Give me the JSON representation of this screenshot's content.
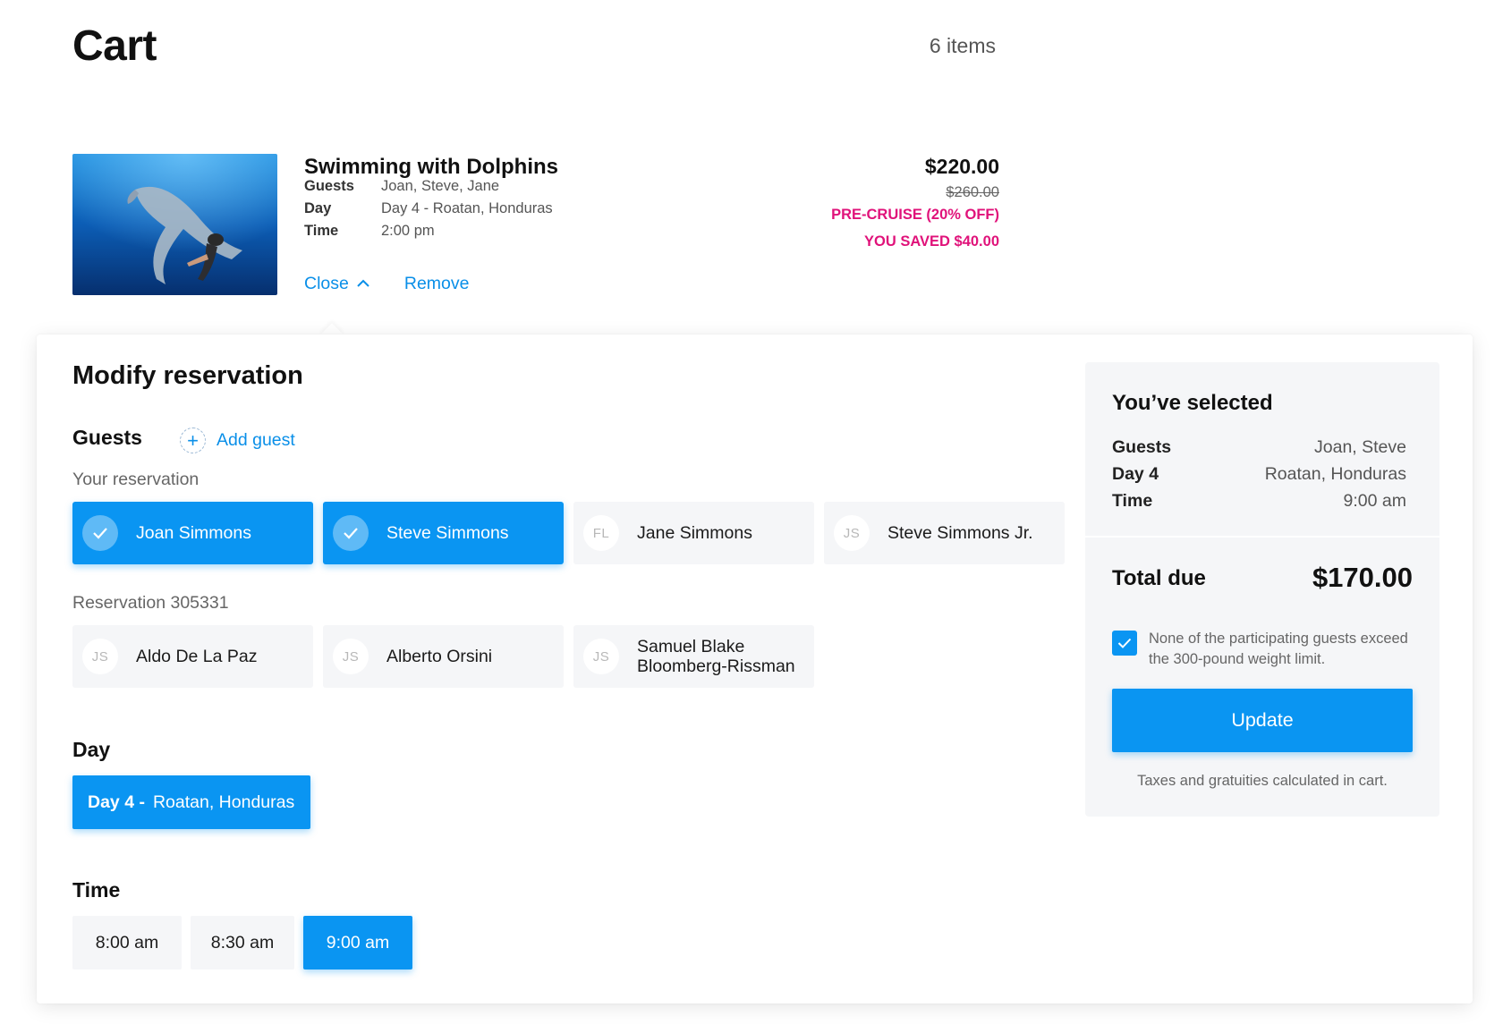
{
  "page": {
    "title": "Cart",
    "items_count": "6 items"
  },
  "cart_item": {
    "title": "Swimming with Dolphins",
    "details": [
      {
        "label": "Guests",
        "value": "Joan, Steve, Jane"
      },
      {
        "label": "Day",
        "value": "Day 4 - Roatan, Honduras"
      },
      {
        "label": "Time",
        "value": "2:00 pm"
      }
    ],
    "close_label": "Close",
    "remove_label": "Remove",
    "price": "$220.00",
    "original_price": "$260.00",
    "discount_label": "PRE-CRUISE (20% OFF)",
    "saved_label": "YOU SAVED $40.00",
    "image_icon": "dolphin-photo"
  },
  "modify": {
    "title": "Modify reservation",
    "guests_heading": "Guests",
    "add_guest_label": "Add guest",
    "your_reservation_label": "Your reservation",
    "your_guests": [
      {
        "initials": "",
        "name": "Joan Simmons",
        "selected": true
      },
      {
        "initials": "",
        "name": "Steve Simmons",
        "selected": true
      },
      {
        "initials": "FL",
        "name": "Jane Simmons",
        "selected": false
      },
      {
        "initials": "JS",
        "name": "Steve Simmons Jr.",
        "selected": false
      }
    ],
    "other_reservation_label": "Reservation 305331",
    "other_guests": [
      {
        "initials": "JS",
        "name": "Aldo De La Paz",
        "selected": false
      },
      {
        "initials": "JS",
        "name": "Alberto Orsini",
        "selected": false
      },
      {
        "initials": "JS",
        "name": "Samuel Blake Bloomberg-Rissman",
        "selected": false
      }
    ],
    "day_heading": "Day",
    "day_option": {
      "day": "Day 4 -",
      "port": "Roatan, Honduras"
    },
    "time_heading": "Time",
    "time_options": [
      {
        "label": "8:00 am",
        "selected": false
      },
      {
        "label": "8:30 am",
        "selected": false
      },
      {
        "label": "9:00 am",
        "selected": true
      }
    ]
  },
  "summary": {
    "title": "You’ve selected",
    "rows": [
      {
        "label": "Guests",
        "value": "Joan, Steve"
      },
      {
        "label": "Day 4",
        "value": "Roatan, Honduras"
      },
      {
        "label": "Time",
        "value": "9:00 am"
      }
    ],
    "total_label": "Total due",
    "total_value": "$170.00",
    "weight_checked": true,
    "weight_text": "None of the participating guests exceed the 300-pound weight limit.",
    "update_label": "Update",
    "taxes_note": "Taxes and gratuities calculated in cart."
  },
  "colors": {
    "accent": "#0a95f2",
    "link": "#0a8fe8",
    "sale": "#e0127a",
    "chip_bg": "#f5f6f8"
  }
}
